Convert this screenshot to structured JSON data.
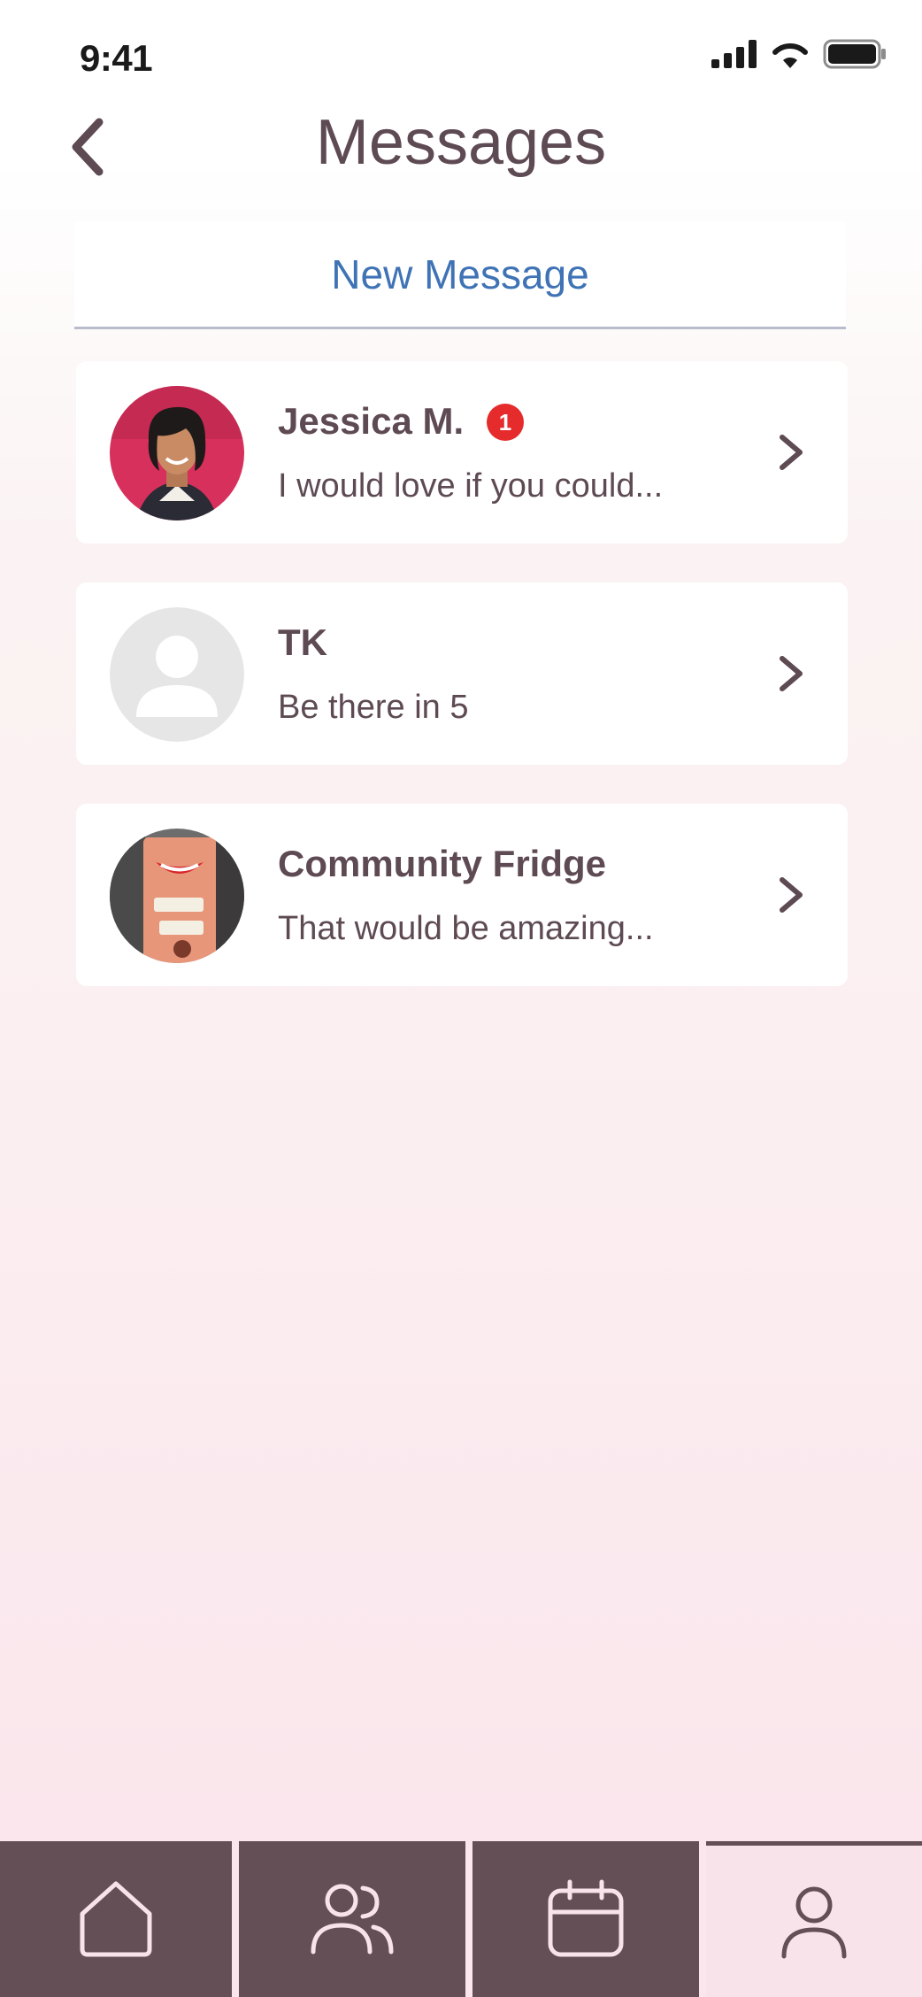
{
  "status_bar": {
    "time": "9:41"
  },
  "header": {
    "title": "Messages"
  },
  "new_message": {
    "label": "New Message"
  },
  "conversations": [
    {
      "name": "Jessica M.",
      "preview": "I would love if you could...",
      "unread": "1"
    },
    {
      "name": "TK",
      "preview": "Be there in 5"
    },
    {
      "name": "Community Fridge",
      "preview": "That would be amazing..."
    }
  ],
  "tab_bar": {
    "tabs": [
      {
        "icon": "home-icon"
      },
      {
        "icon": "people-icon"
      },
      {
        "icon": "calendar-icon"
      },
      {
        "icon": "profile-icon",
        "active": true
      }
    ]
  },
  "colors": {
    "primary_text": "#5e4a53",
    "link": "#3f73b5",
    "badge": "#e52b2b",
    "tab_bar": "#634f55",
    "tab_active": "#f9e3ea"
  }
}
